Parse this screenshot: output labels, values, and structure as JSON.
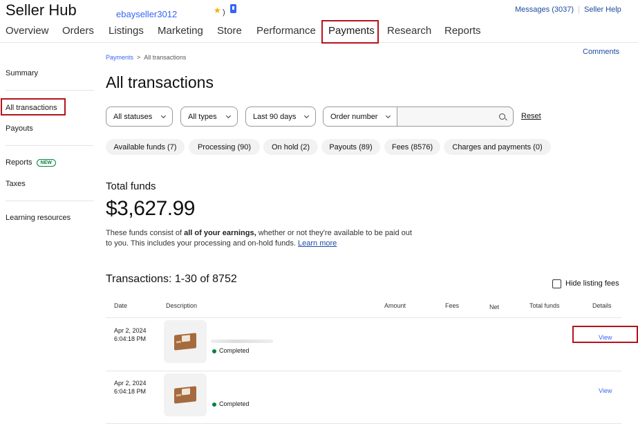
{
  "header": {
    "app_title": "Seller Hub",
    "seller_name": "ebayseller3012",
    "star": "★",
    "paren": ")",
    "messages": "Messages (3037)",
    "separator": "|",
    "help": "Seller Help"
  },
  "nav": {
    "overview": "Overview",
    "orders": "Orders",
    "listings": "Listings",
    "marketing": "Marketing",
    "store": "Store",
    "performance": "Performance",
    "payments": "Payments",
    "research": "Research",
    "reports": "Reports",
    "active": "Payments"
  },
  "sidebar": {
    "summary": "Summary",
    "all_transactions": "All transactions",
    "payouts": "Payouts",
    "reports": "Reports",
    "reports_badge": "NEW",
    "taxes": "Taxes",
    "learning": "Learning resources"
  },
  "breadcrumb": {
    "parent": "Payments",
    "separator": ">",
    "current": "All transactions"
  },
  "comments": "Comments",
  "page_title": "All transactions",
  "filters": {
    "status": "All statuses",
    "type": "All types",
    "period": "Last 90 days",
    "order": "Order number",
    "search_value": "",
    "reset": "Reset"
  },
  "chips": {
    "available": "Available funds (7)",
    "processing": "Processing (90)",
    "on_hold": "On hold (2)",
    "payouts": "Payouts (89)",
    "fees": "Fees (8576)",
    "charges": "Charges and payments (0)"
  },
  "funds": {
    "title": "Total funds",
    "amount": "$3,627.99",
    "desc_pre": "These funds consist of ",
    "desc_bold": "all of your earnings,",
    "desc_post": " whether or not they're available to be paid out to you. This includes your processing and on-hold funds. ",
    "learn_more": "Learn more"
  },
  "transactions": {
    "count": "Transactions: 1-30 of 8752",
    "hide_fees": "Hide listing fees",
    "columns": {
      "date": "Date",
      "description": "Description",
      "amount": "Amount",
      "fees": "Fees",
      "net": "Net",
      "total": "Total funds",
      "details": "Details"
    },
    "rows": [
      {
        "date": "Apr 2, 2024",
        "time": "6:04:18 PM",
        "status": "Completed",
        "view": "View"
      },
      {
        "date": "Apr 2, 2024",
        "time": "6:04:18 PM",
        "status": "Completed",
        "view": "View"
      }
    ]
  },
  "colors": {
    "link_blue": "#3665f3",
    "highlight_red": "#b5121b",
    "status_green": "#05823f"
  }
}
